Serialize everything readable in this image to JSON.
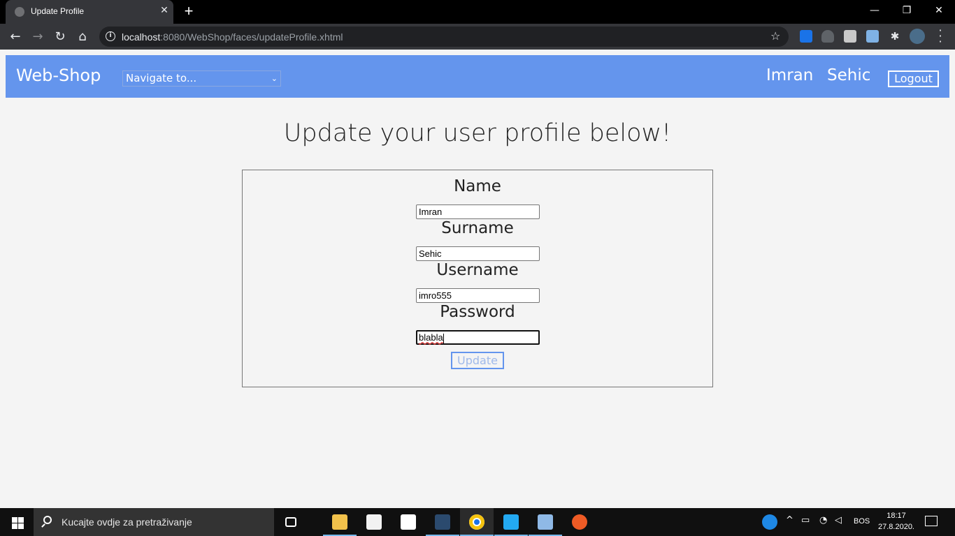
{
  "browser": {
    "tab_title": "Update Profile",
    "url_host": "localhost",
    "url_rest": ":8080/WebShop/faces/updateProfile.xhtml"
  },
  "page": {
    "brand": "Web-Shop",
    "navigate_select": {
      "selected": "Navigate to..."
    },
    "user_first_name": "Imran",
    "user_last_name": "Sehic",
    "logout_label": "Logout",
    "heading": "Update your user profile below!"
  },
  "form": {
    "fields": [
      {
        "label": "Name",
        "value": "Imran"
      },
      {
        "label": "Surname",
        "value": "Sehic"
      },
      {
        "label": "Username",
        "value": "imro555"
      },
      {
        "label": "Password",
        "value": "blabla"
      }
    ],
    "submit_label": "Update"
  },
  "taskbar": {
    "search_placeholder": "Kucajte ovdje za pretraživanje",
    "language": "BOS",
    "time": "18:17",
    "date": "27.8.2020."
  },
  "colors": {
    "nav_bg": "#6495ed",
    "page_bg": "#f4f4f4"
  }
}
